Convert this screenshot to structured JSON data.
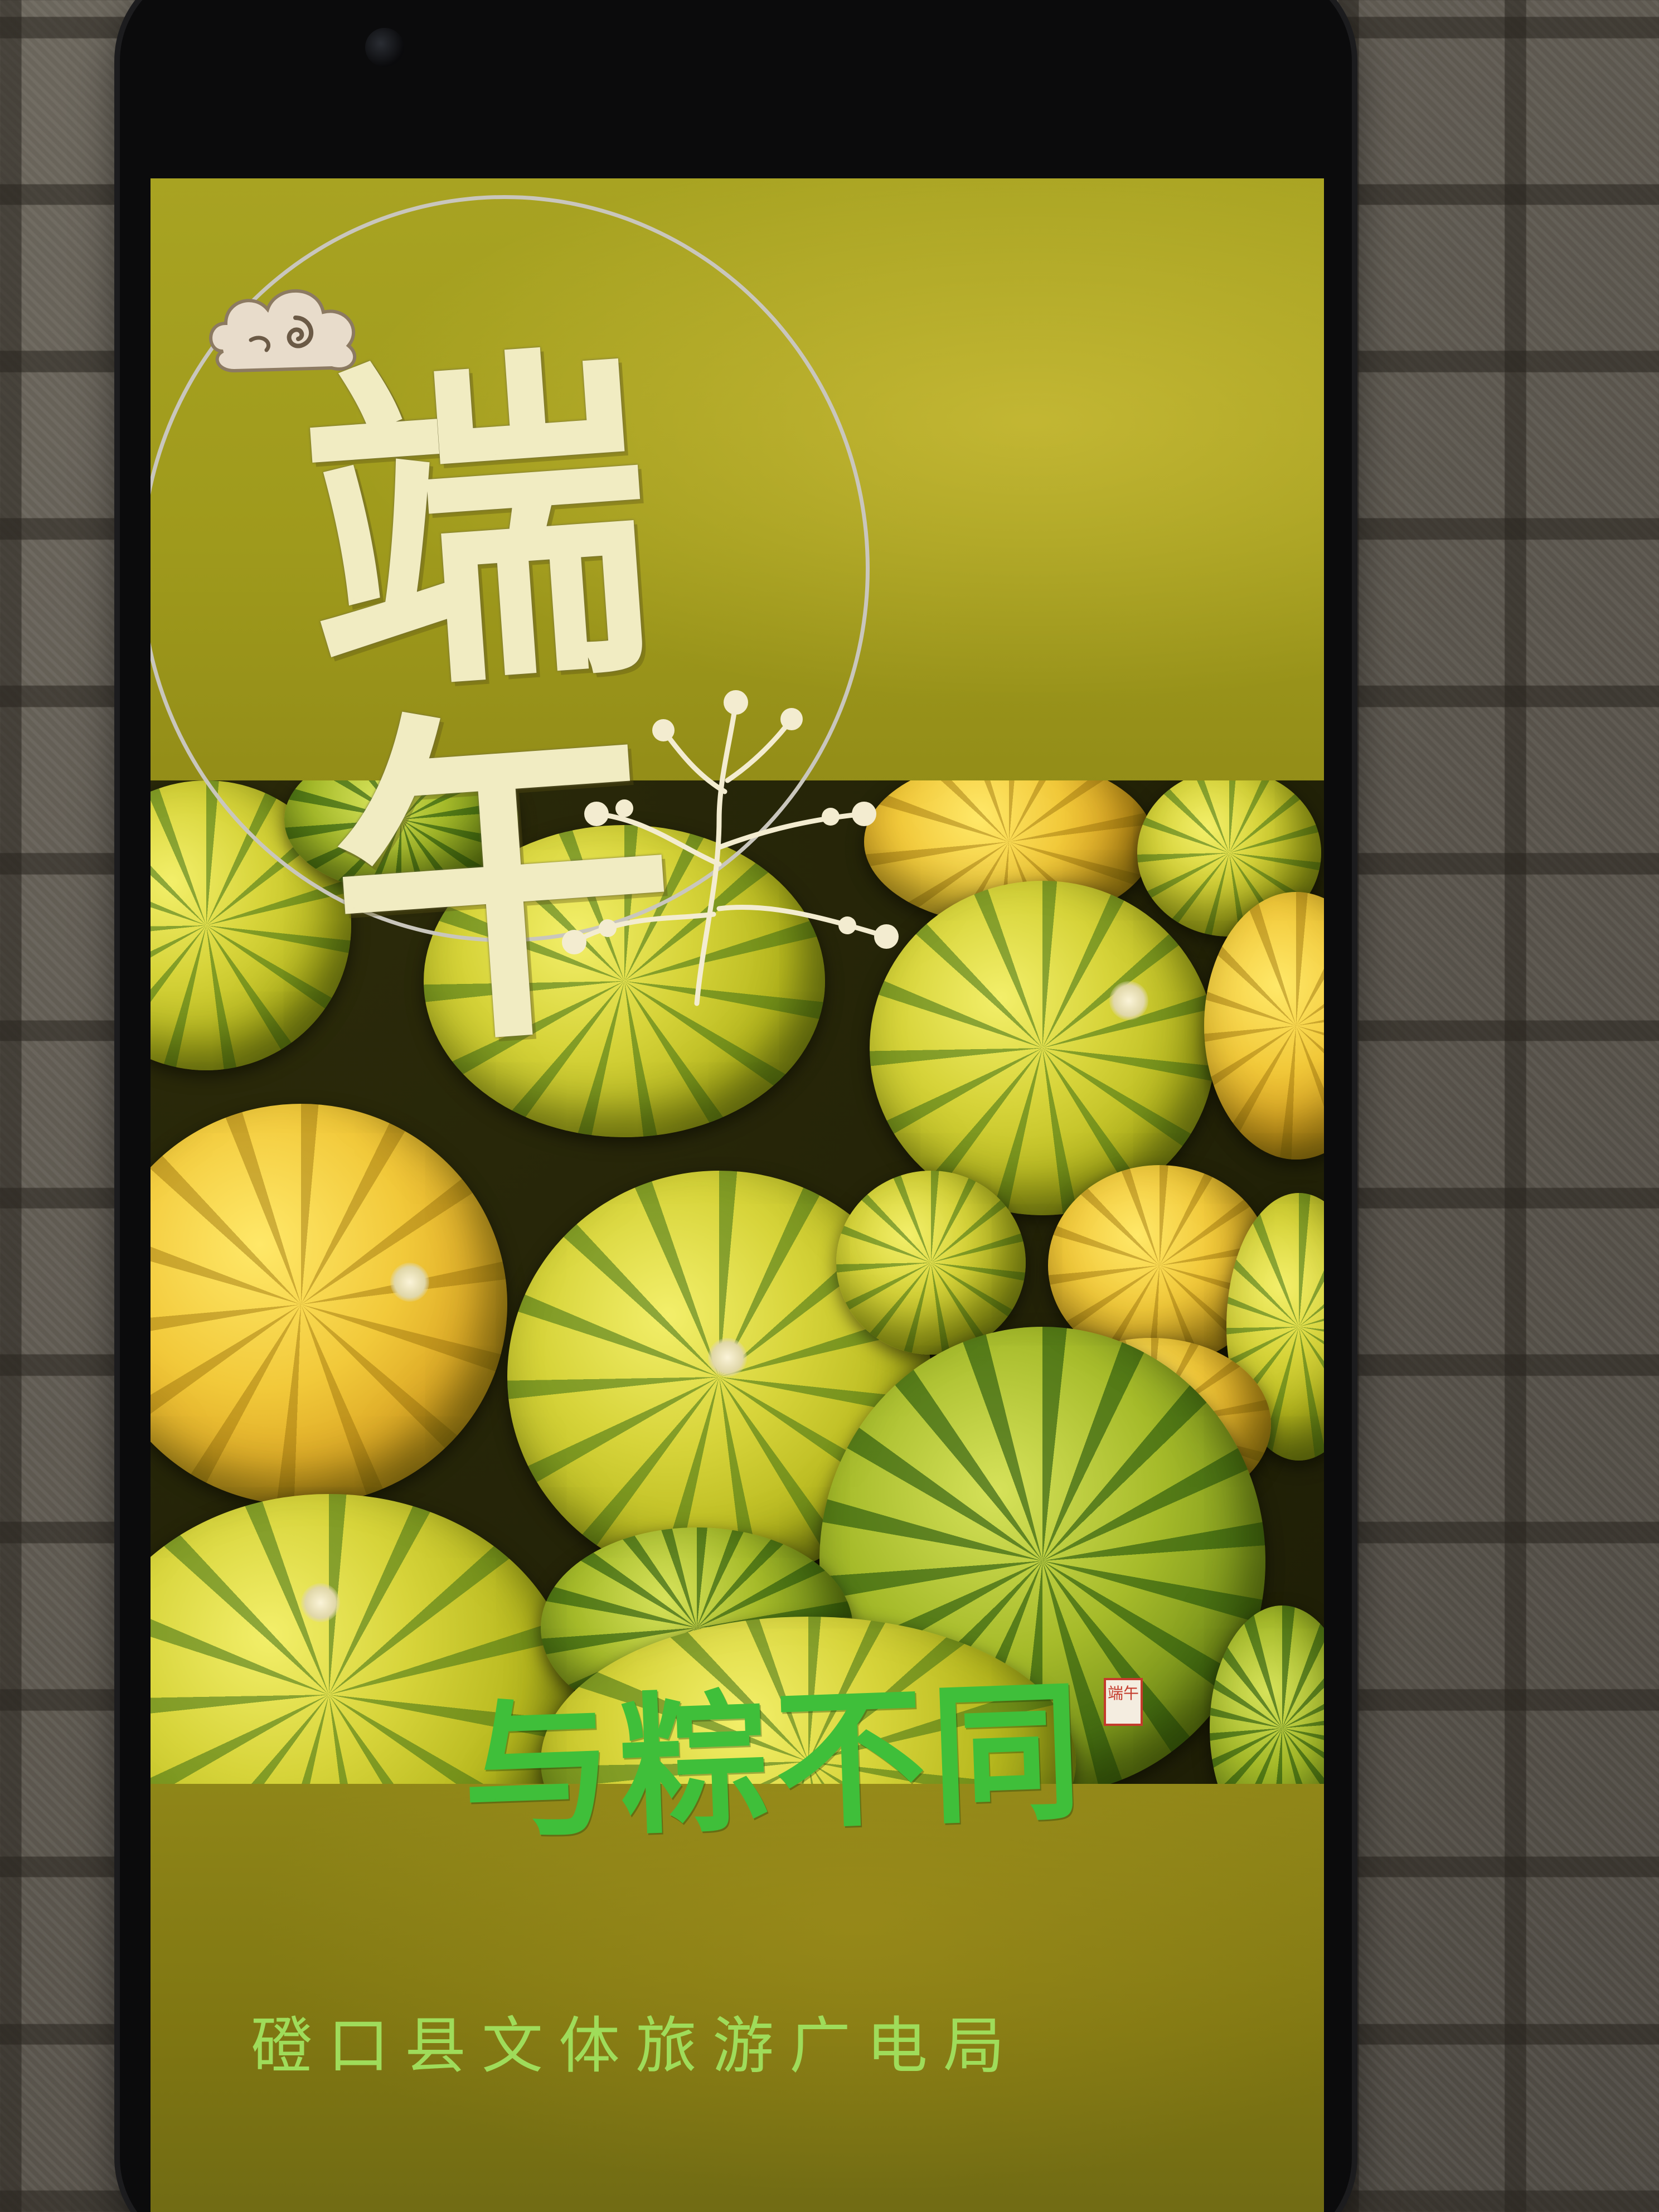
{
  "poster": {
    "title_char_1": "端",
    "title_char_2": "午",
    "slogan": "与粽不同",
    "seal_text": "端午",
    "organization": "磴口县文体旅游广电局"
  },
  "colors": {
    "title": "#f1ecc2",
    "slogan": "#3fbf3a",
    "organization": "#9fdc5a",
    "seal": "#c43b2c",
    "background_gold": "#a8a322"
  },
  "icons": [
    "cloud-icon",
    "sprig-icon",
    "seal-icon"
  ]
}
